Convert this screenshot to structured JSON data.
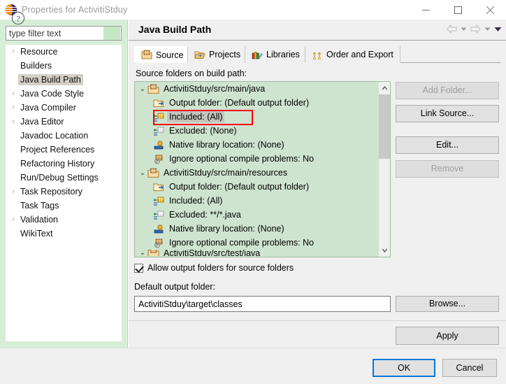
{
  "window": {
    "title": "Properties for ActivitiStduy",
    "app_icon": "eclipse-icon",
    "minimize_label": "—",
    "maximize_label": "□",
    "close_label": "✕"
  },
  "sidebar": {
    "filter": {
      "placeholder": "type filter text",
      "value": ""
    },
    "items": [
      {
        "label": "Resource",
        "expandable": true,
        "selected": false
      },
      {
        "label": "Builders",
        "expandable": false,
        "selected": false
      },
      {
        "label": "Java Build Path",
        "expandable": false,
        "selected": true
      },
      {
        "label": "Java Code Style",
        "expandable": true,
        "selected": false
      },
      {
        "label": "Java Compiler",
        "expandable": true,
        "selected": false
      },
      {
        "label": "Java Editor",
        "expandable": true,
        "selected": false
      },
      {
        "label": "Javadoc Location",
        "expandable": false,
        "selected": false
      },
      {
        "label": "Project References",
        "expandable": false,
        "selected": false
      },
      {
        "label": "Refactoring History",
        "expandable": false,
        "selected": false
      },
      {
        "label": "Run/Debug Settings",
        "expandable": false,
        "selected": false
      },
      {
        "label": "Task Repository",
        "expandable": true,
        "selected": false
      },
      {
        "label": "Task Tags",
        "expandable": false,
        "selected": false
      },
      {
        "label": "Validation",
        "expandable": true,
        "selected": false
      },
      {
        "label": "WikiText",
        "expandable": false,
        "selected": false
      }
    ]
  },
  "page": {
    "title": "Java Build Path",
    "nav": {
      "back_icon": "back-arrow-icon",
      "forward_icon": "forward-arrow-icon",
      "menu_icon": "chevron-down-icon"
    }
  },
  "tabs": [
    {
      "label": "Source",
      "icon": "source-folder-icon",
      "active": true
    },
    {
      "label": "Projects",
      "icon": "open-folder-icon",
      "active": false
    },
    {
      "label": "Libraries",
      "icon": "books-icon",
      "active": false
    },
    {
      "label": "Order and Export",
      "icon": "order-export-icon",
      "active": false
    }
  ],
  "source_tab": {
    "list_label": "Source folders on build path:",
    "tree": [
      {
        "text": "ActivitiStduy/src/main/java",
        "level": 0,
        "icon": "package-folder-icon",
        "twisty": "⌄",
        "selected": false,
        "highlighted": false
      },
      {
        "text": "Output folder: (Default output folder)",
        "level": 1,
        "icon": "output-folder-icon",
        "twisty": "",
        "selected": false,
        "highlighted": false
      },
      {
        "text": "Included: (All)",
        "level": 1,
        "icon": "include-icon",
        "twisty": "",
        "selected": true,
        "highlighted": true
      },
      {
        "text": "Excluded: (None)",
        "level": 1,
        "icon": "exclude-icon",
        "twisty": "",
        "selected": false,
        "highlighted": false
      },
      {
        "text": "Native library location: (None)",
        "level": 1,
        "icon": "native-library-icon",
        "twisty": "",
        "selected": false,
        "highlighted": false
      },
      {
        "text": "Ignore optional compile problems: No",
        "level": 1,
        "icon": "ignore-problems-icon",
        "twisty": "",
        "selected": false,
        "highlighted": false
      },
      {
        "text": "ActivitiStduy/src/main/resources",
        "level": 0,
        "icon": "package-folder-icon",
        "twisty": "⌄",
        "selected": false,
        "highlighted": false
      },
      {
        "text": "Output folder: (Default output folder)",
        "level": 1,
        "icon": "output-folder-icon",
        "twisty": "",
        "selected": false,
        "highlighted": false
      },
      {
        "text": "Included: (All)",
        "level": 1,
        "icon": "include-icon",
        "twisty": "",
        "selected": false,
        "highlighted": false
      },
      {
        "text": "Excluded: **/*.java",
        "level": 1,
        "icon": "exclude-icon",
        "twisty": "",
        "selected": false,
        "highlighted": false
      },
      {
        "text": "Native library location: (None)",
        "level": 1,
        "icon": "native-library-icon",
        "twisty": "",
        "selected": false,
        "highlighted": false
      },
      {
        "text": "Ignore optional compile problems: No",
        "level": 1,
        "icon": "ignore-problems-icon",
        "twisty": "",
        "selected": false,
        "highlighted": false
      },
      {
        "text": "ActivitiStduy/src/test/java",
        "level": 0,
        "icon": "package-folder-icon",
        "twisty": "⌄",
        "selected": false,
        "highlighted": false,
        "clipped": true
      }
    ],
    "buttons": {
      "add_folder": "Add Folder...",
      "link_source": "Link Source...",
      "edit": "Edit...",
      "remove": "Remove"
    },
    "allow_output_folders": {
      "label": "Allow output folders for source folders",
      "checked": true
    },
    "default_output_folder": {
      "label": "Default output folder:",
      "value": "ActivitiStduy\\target\\classes",
      "browse_label": "Browse..."
    },
    "apply_label": "Apply"
  },
  "footer": {
    "help_icon": "help-question-icon",
    "ok_label": "OK",
    "cancel_label": "Cancel"
  },
  "colors": {
    "sidebar_bg": "#d6eed6",
    "tree_bg": "#cfe4cf",
    "annotation_red": "#ff0000",
    "ok_focus_blue": "#0078d7",
    "selection_gray": "#c4c4bc"
  }
}
